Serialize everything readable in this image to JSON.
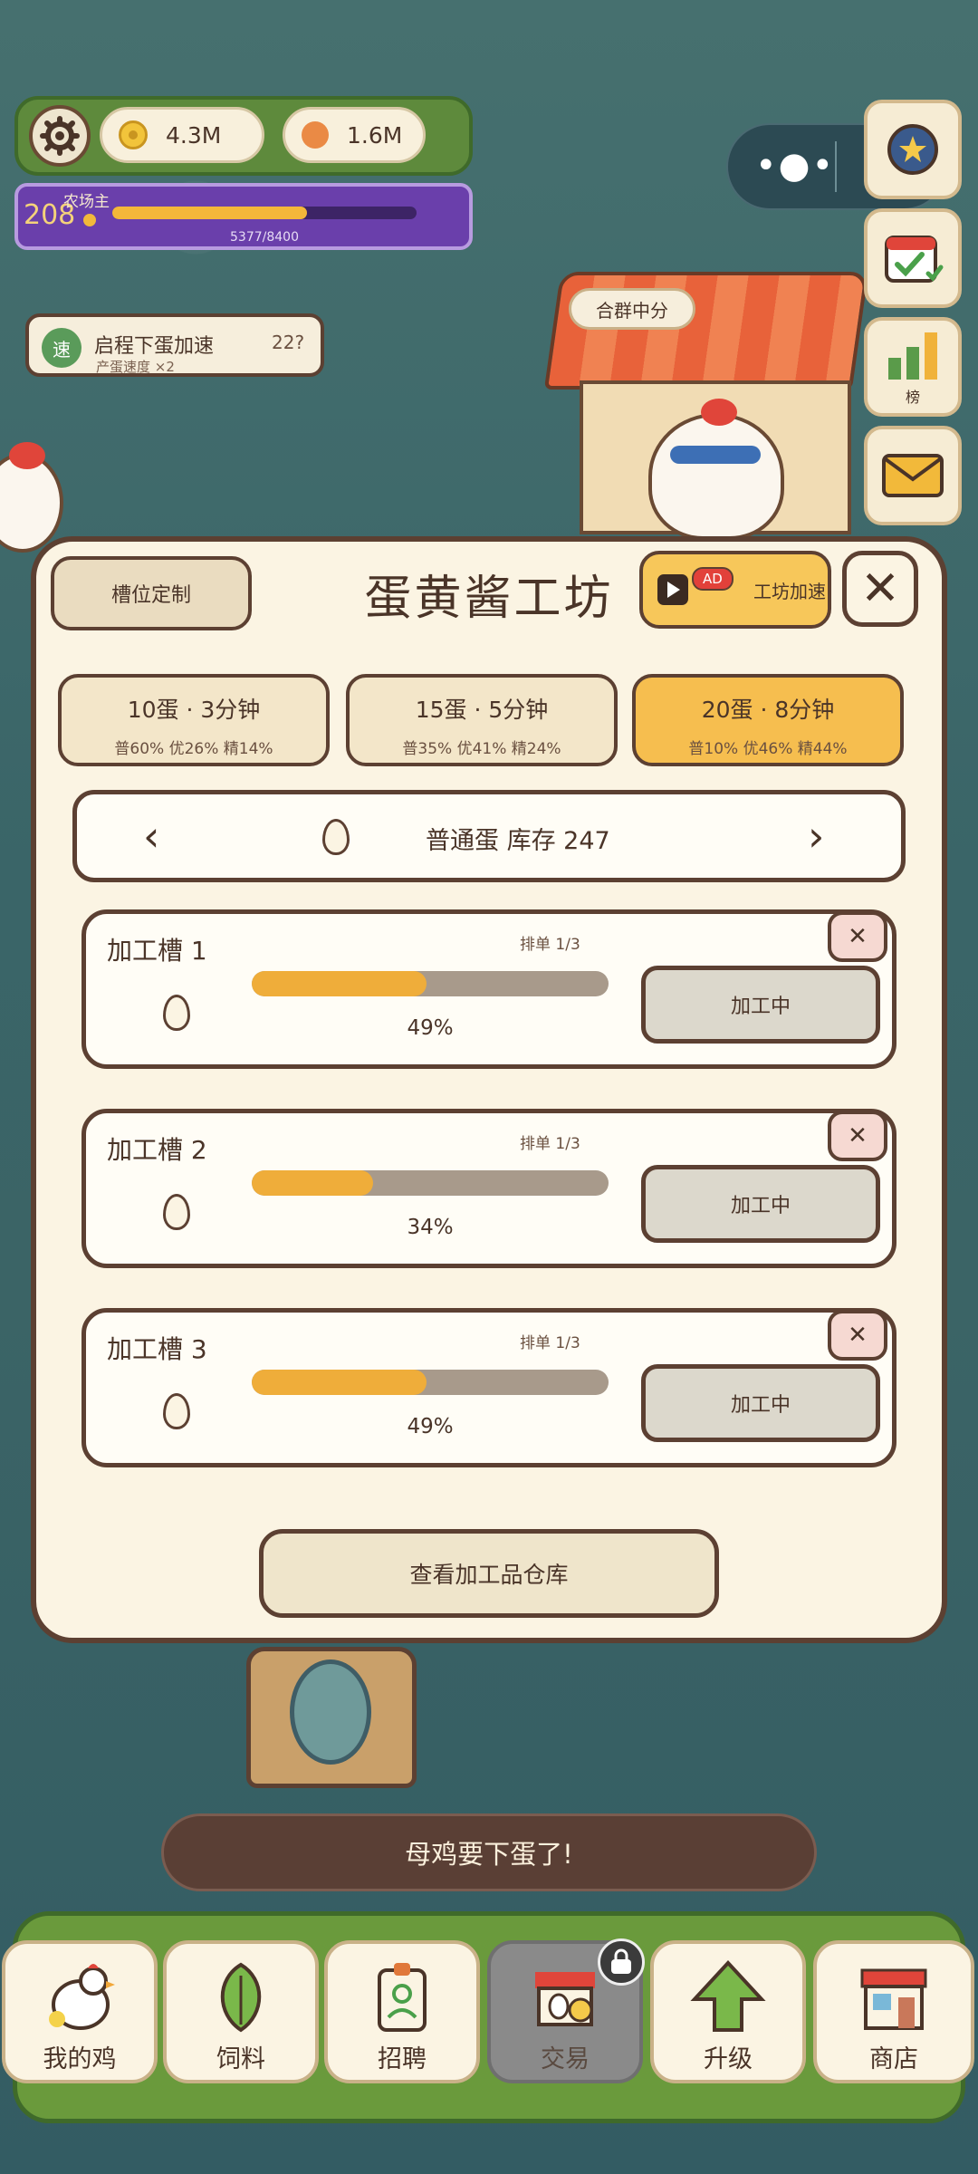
{
  "resources": {
    "coins": "4.3M",
    "eggs": "1.6M"
  },
  "level": {
    "number": "208",
    "title": "农场主",
    "xp_text": "5377/8400",
    "progress": 0.64
  },
  "side_buttons": [
    {
      "label": "",
      "icon": "medal-icon"
    },
    {
      "label": "",
      "icon": "calendar-check-icon"
    },
    {
      "label": "榜",
      "icon": "leaderboard-icon"
    },
    {
      "label": "",
      "icon": "mail-icon"
    }
  ],
  "buff": {
    "badge": "速",
    "title": "启程下蛋加速",
    "subtitle": "产蛋速度 ×2",
    "time": "22?"
  },
  "house_sign": "合群中分",
  "panel": {
    "slot_custom_label": "槽位定制",
    "title": "蛋黄酱工坊",
    "ad_label": "AD",
    "speedup_label": "工坊加速",
    "close_label": "✕"
  },
  "recipes": [
    {
      "main": "10蛋 · 3分钟",
      "sub": "普60% 优26% 精14%",
      "selected": false
    },
    {
      "main": "15蛋 · 5分钟",
      "sub": "普35% 优41% 精24%",
      "selected": false
    },
    {
      "main": "20蛋 · 8分钟",
      "sub": "普10% 优46% 精44%",
      "selected": true
    }
  ],
  "egg_selector": {
    "prev": "‹",
    "next": "›",
    "label": "普通蛋  库存 247"
  },
  "slots": [
    {
      "name": "加工槽 1",
      "queue": "排单 1/3",
      "progress": 0.49,
      "percent": "49%",
      "status": "加工中",
      "cancel": "✕"
    },
    {
      "name": "加工槽 2",
      "queue": "排单 1/3",
      "progress": 0.34,
      "percent": "34%",
      "status": "加工中",
      "cancel": "✕"
    },
    {
      "name": "加工槽 3",
      "queue": "排单 1/3",
      "progress": 0.49,
      "percent": "49%",
      "status": "加工中",
      "cancel": "✕"
    }
  ],
  "warehouse_button": "查看加工品仓库",
  "toast": "母鸡要下蛋了!",
  "nav": [
    {
      "label": "我的鸡",
      "icon": "chicken-icon",
      "active": false
    },
    {
      "label": "饲料",
      "icon": "leaf-icon",
      "active": false
    },
    {
      "label": "招聘",
      "icon": "badge-icon",
      "active": false
    },
    {
      "label": "交易",
      "icon": "market-stall-icon",
      "active": true,
      "locked": true
    },
    {
      "label": "升级",
      "icon": "up-arrow-icon",
      "active": false
    },
    {
      "label": "商店",
      "icon": "shop-icon",
      "active": false
    }
  ],
  "colors": {
    "accent_orange": "#f6be4f",
    "panel_bg": "#fbf4e3",
    "border_brown": "#5c4032",
    "progress_fill": "#efad3a",
    "level_purple": "#6a3fab"
  }
}
